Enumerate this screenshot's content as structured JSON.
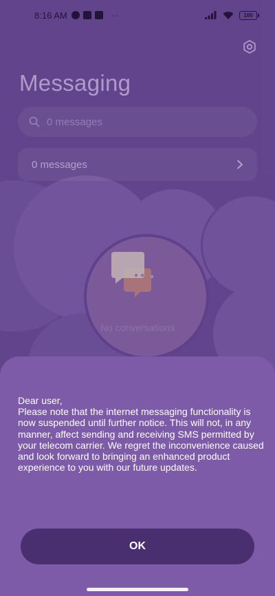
{
  "status_bar": {
    "time": "8:16 AM",
    "notification_icons": [
      "sync-icon",
      "square-icon",
      "notification-app-icon"
    ],
    "overflow": "··",
    "battery": "100"
  },
  "header": {
    "title": "Messaging",
    "settings_icon": "gear-icon"
  },
  "search": {
    "placeholder": "0 messages"
  },
  "messages_card": {
    "label": "0 messages"
  },
  "empty_state": {
    "label": "No conversations"
  },
  "dialog": {
    "greeting": "Dear user,",
    "body": "Please note that the internet messaging functionality is now suspended until further notice. This will not, in any manner, affect sending and receiving SMS permitted by your telecom carrier. We regret the inconvenience caused and look forward to bringing an enhanced product experience to you with our future updates.",
    "ok_label": "OK"
  },
  "colors": {
    "background": "#6a4e98",
    "sheet": "#7d5ba8",
    "button": "#4a2f70",
    "title_text": "#c9b8e4"
  }
}
